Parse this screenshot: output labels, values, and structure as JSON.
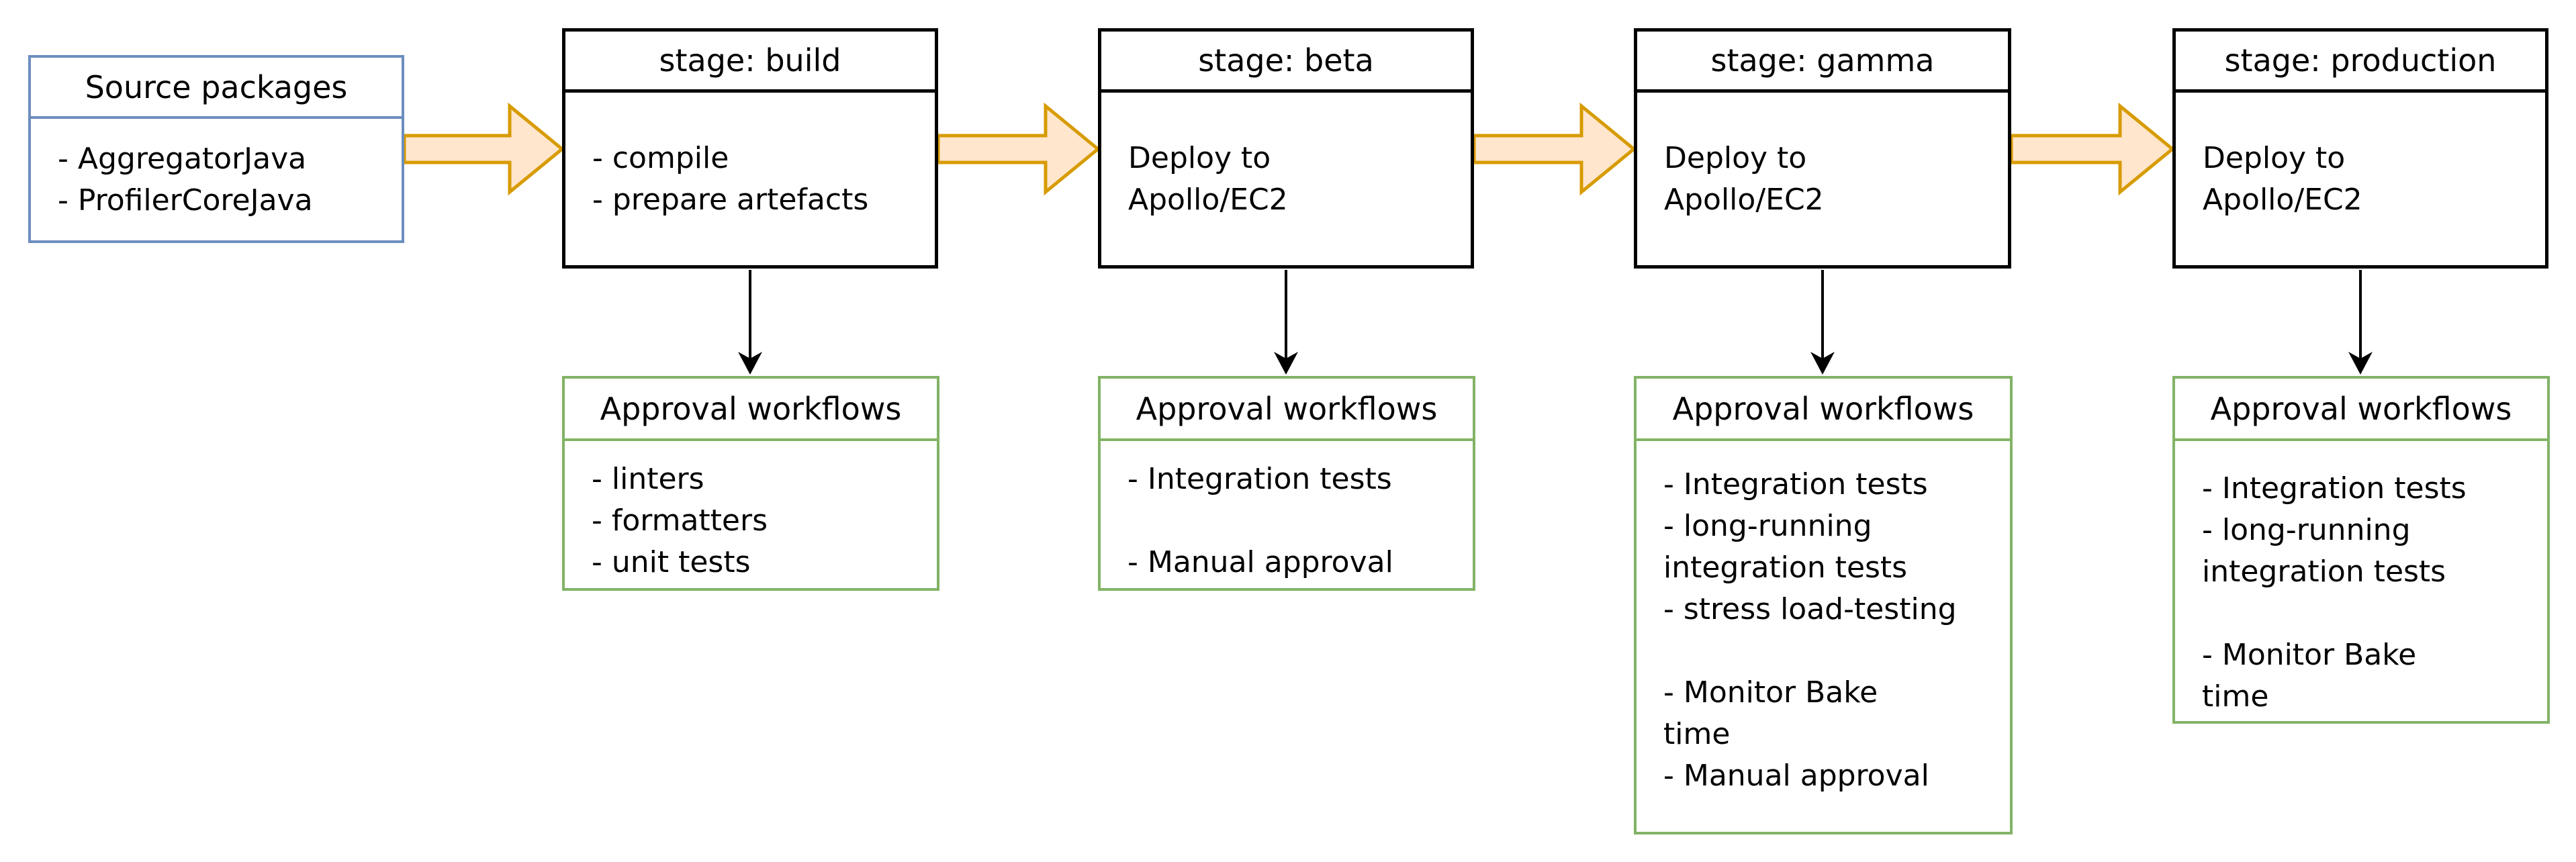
{
  "colors": {
    "source_stroke": "#6c8ebf",
    "stage_stroke": "#000000",
    "approval_stroke": "#82b366",
    "flow_arrow_fill": "#ffe6cc",
    "flow_arrow_stroke": "#d79b00",
    "connector": "#000000"
  },
  "source": {
    "title": "Source packages",
    "items": [
      "- AggregatorJava",
      "- ProfilerCoreJava"
    ]
  },
  "stages": [
    {
      "title": "stage: build",
      "lines": [
        "- compile",
        "- prepare artefacts"
      ],
      "approval": {
        "title": "Approval workflows",
        "lines": [
          "- linters",
          "- formatters",
          "- unit tests"
        ]
      }
    },
    {
      "title": "stage: beta",
      "lines": [
        "Deploy to",
        "Apollo/EC2"
      ],
      "approval": {
        "title": "Approval workflows",
        "lines": [
          "- Integration tests",
          "",
          "- Manual approval"
        ]
      }
    },
    {
      "title": "stage: gamma",
      "lines": [
        "Deploy to",
        "Apollo/EC2"
      ],
      "approval": {
        "title": "Approval workflows",
        "lines": [
          "",
          "- Integration tests",
          "- long-running",
          "integration tests",
          "- stress load-testing",
          "",
          "- Monitor Bake",
          "time",
          "- Manual approval"
        ]
      }
    },
    {
      "title": "stage: production",
      "lines": [
        "Deploy to",
        "Apollo/EC2"
      ],
      "approval": {
        "title": "Approval workflows",
        "lines": [
          "- Integration tests",
          "- long-running",
          "integration tests",
          "",
          "- Monitor Bake",
          "time"
        ]
      }
    }
  ]
}
